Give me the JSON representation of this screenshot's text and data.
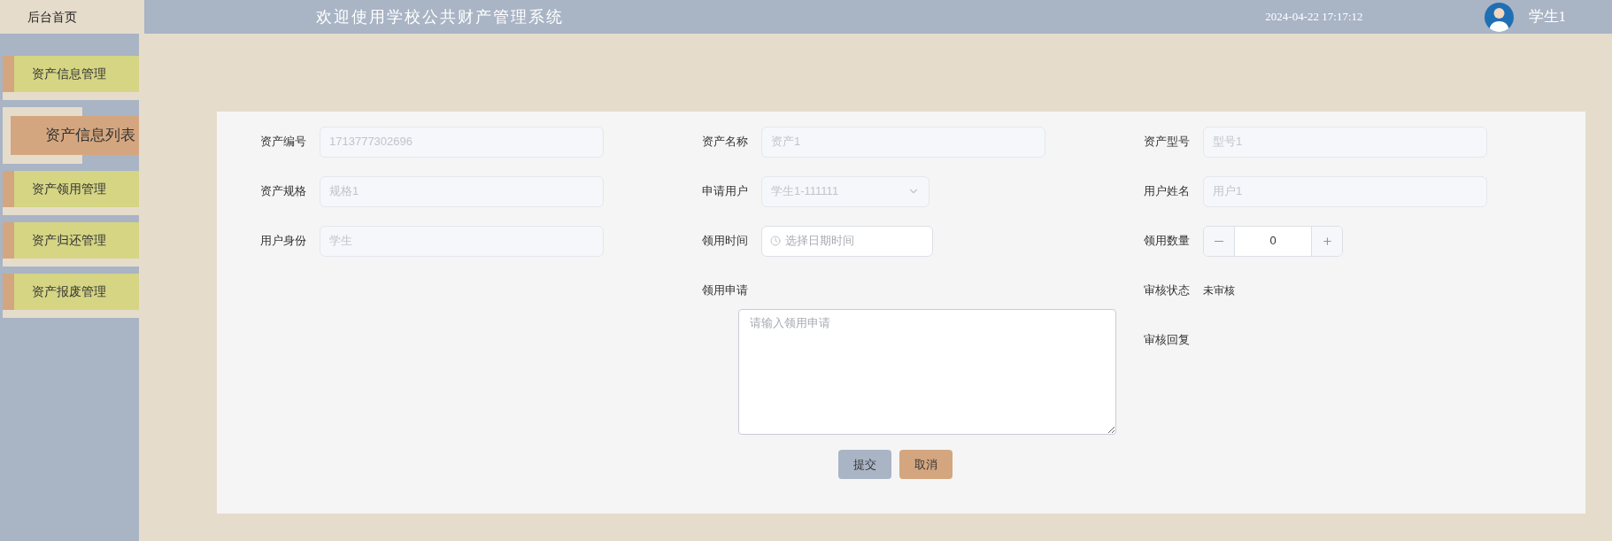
{
  "header": {
    "home_link": "后台首页",
    "title": "欢迎使用学校公共财产管理系统",
    "datetime": "2024-04-22 17:17:12",
    "user_name": "学生1"
  },
  "sidebar": {
    "items": [
      {
        "kind": "menu",
        "label": "资产信息管理",
        "selected": false
      },
      {
        "kind": "submenu",
        "label": "资产信息列表",
        "selected": true
      },
      {
        "kind": "menu",
        "label": "资产领用管理",
        "selected": false
      },
      {
        "kind": "menu",
        "label": "资产归还管理",
        "selected": false
      },
      {
        "kind": "menu",
        "label": "资产报废管理",
        "selected": false
      }
    ]
  },
  "form": {
    "columns": [
      {
        "fields": [
          {
            "kind": "input",
            "label": "资产编号",
            "value": "1713777302696",
            "disabled": true
          },
          {
            "kind": "input",
            "label": "资产规格",
            "value": "规格1",
            "disabled": true
          },
          {
            "kind": "input",
            "label": "用户身份",
            "value": "学生",
            "disabled": true
          }
        ]
      },
      {
        "fields": [
          {
            "kind": "input",
            "label": "资产名称",
            "value": "资产1",
            "disabled": true
          },
          {
            "kind": "select",
            "label": "申请用户",
            "value": "学生1-111111",
            "disabled": true
          },
          {
            "kind": "datetime",
            "label": "领用时间",
            "placeholder": "选择日期时间"
          },
          {
            "kind": "textarea",
            "label": "领用申请",
            "placeholder": "请输入领用申请"
          }
        ]
      },
      {
        "fields": [
          {
            "kind": "input",
            "label": "资产型号",
            "value": "型号1",
            "disabled": true
          },
          {
            "kind": "input",
            "label": "用户姓名",
            "value": "用户1",
            "disabled": true
          },
          {
            "kind": "number",
            "label": "领用数量",
            "value": "0"
          },
          {
            "kind": "text",
            "label": "审核状态",
            "value": "未审核"
          },
          {
            "kind": "text",
            "label": "审核回复"
          }
        ]
      }
    ],
    "buttons": [
      {
        "kind": "primary",
        "label": "提交"
      },
      {
        "kind": "secondary",
        "label": "取消"
      }
    ]
  }
}
